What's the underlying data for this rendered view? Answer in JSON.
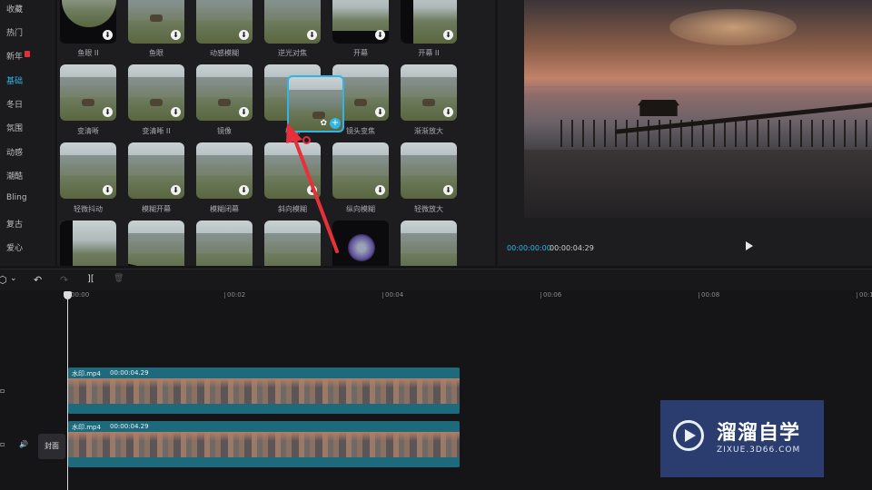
{
  "sidebar": {
    "items": [
      {
        "label": "收藏"
      },
      {
        "label": "热门"
      },
      {
        "label": "新年"
      },
      {
        "label": "基础",
        "active": true
      },
      {
        "label": "冬日"
      },
      {
        "label": "氛围"
      },
      {
        "label": "动感"
      },
      {
        "label": "潮酷"
      },
      {
        "label": "Bling"
      },
      {
        "label": "复古"
      },
      {
        "label": "爱心"
      }
    ]
  },
  "effects": {
    "row1": [
      "鱼眼 II",
      "鱼眼",
      "动感模糊",
      "逆光对焦",
      "开幕",
      "开幕 II"
    ],
    "row2": [
      "变清晰",
      "变清晰 II",
      "镜像",
      "模糊",
      "镜头变焦",
      "渐渐放大"
    ],
    "row3": [
      "轻微抖动",
      "模糊开幕",
      "模糊闭幕",
      "斜向模糊",
      "纵向模糊",
      "轻微放大"
    ],
    "download_glyph": "⬇",
    "drag_plus": "+",
    "drag_star": "✿"
  },
  "preview": {
    "current_time": "00:00:00:00",
    "total_time": "00:00:04:29"
  },
  "toolbar": {
    "undo_icon": "↶",
    "redo_icon": "↷",
    "split_icon": "][",
    "delete_icon": "🗑",
    "select_icon": "⬡",
    "dropdown_icon": "⌄"
  },
  "ruler": {
    "labels": [
      "00:00",
      "00:02",
      "00:04",
      "00:06",
      "00:08",
      "00:10"
    ]
  },
  "tracks": [
    {
      "name": "水印.mp4",
      "duration": "00:00:04.29"
    },
    {
      "name": "水印.mp4",
      "duration": "00:00:04.29"
    }
  ],
  "track_controls": {
    "audio_icon": "🔊",
    "cover_label": "封面"
  },
  "watermark": {
    "title": "溜溜自学",
    "url": "ZIXUE.3D66.COM"
  },
  "colors": {
    "accent": "#2fb5e6",
    "clip": "#1d6a7c",
    "arrow": "#e8303a",
    "badge": "#e0303a"
  }
}
